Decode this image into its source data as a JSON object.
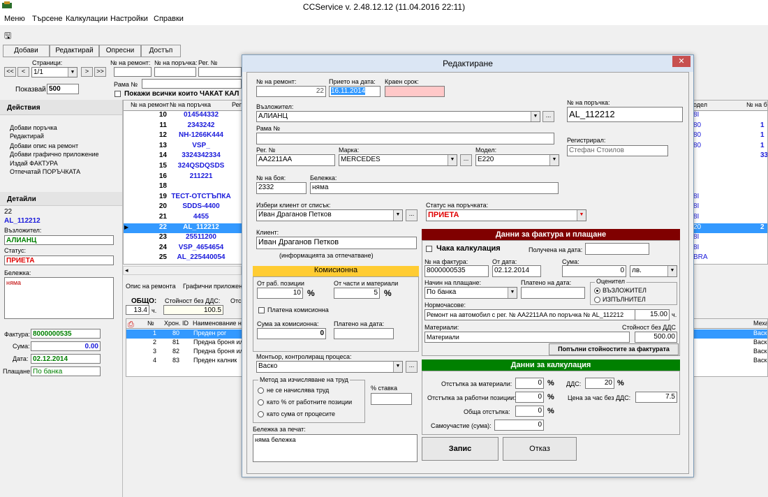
{
  "app": {
    "title": "CCService v. 2.48.12.12 (11.04.2016 22:11)"
  },
  "menu": [
    "Меню",
    "Търсене",
    "Калкулации",
    "Настройки",
    "Справки"
  ],
  "tabs": [
    "Добави",
    "Редактирай",
    "Опресни",
    "Достъп"
  ],
  "filters": {
    "pages_label": "Страници:",
    "pages_value": "1/1",
    "show_label": "Показвай",
    "show_value": "500",
    "repair_no_label": "№ на ремонт:",
    "order_no_label": "№ на поръчка:",
    "reg_no_label": "Рег. №",
    "frame_label": "Рама №",
    "checkbox_label": "Покажи всички които ЧАКАТ КАЛ"
  },
  "actions": {
    "title": "Действия",
    "items": [
      "Добави поръчка",
      "Редактирай",
      "Добави опис на ремонт",
      "Добави графично приложение",
      "Издай ФАКТУРА",
      "Отпечатай ПОРЪЧКАТА"
    ]
  },
  "details": {
    "title": "Детайли",
    "repair_no": "22",
    "order_no": "AL_112212",
    "client_label": "Възложител:",
    "client": "АЛИАНЦ",
    "status_label": "Статус:",
    "status": "ПРИЕТА",
    "note_label": "Бележка:",
    "note": "няма",
    "invoice_label": "Фактура:",
    "invoice": "8000000535",
    "sum_label": "Сума:",
    "sum": "0.00",
    "date_label": "Дата:",
    "date": "02.12.2014",
    "payment_label": "Плащане:",
    "payment": "По банка"
  },
  "grid": {
    "headers": [
      "№ на ремонт",
      "№ на поръчка",
      "Рег",
      "одел",
      "№ на бо"
    ],
    "rows": [
      {
        "n": "10",
        "o": "014544332",
        "m": "8I",
        "x": ""
      },
      {
        "n": "11",
        "o": "2343242",
        "m": "80",
        "x": "1"
      },
      {
        "n": "12",
        "o": "NH-1266K444",
        "m": "80",
        "x": "1"
      },
      {
        "n": "13",
        "o": "VSP_",
        "m": "80",
        "x": "1"
      },
      {
        "n": "14",
        "o": "3324342334",
        "m": "",
        "x": "33"
      },
      {
        "n": "15",
        "o": "324QSDQSDS",
        "m": "",
        "x": ""
      },
      {
        "n": "16",
        "o": "211221",
        "m": "",
        "x": ""
      },
      {
        "n": "18",
        "o": "",
        "m": "",
        "x": ""
      },
      {
        "n": "19",
        "o": "ТЕСТ-ОТСТЪПКА",
        "m": "8I",
        "x": ""
      },
      {
        "n": "20",
        "o": "SDDS-4400",
        "m": "8I",
        "x": ""
      },
      {
        "n": "21",
        "o": "4455",
        "m": "8I",
        "x": ""
      },
      {
        "n": "22",
        "o": "AL_112212",
        "m": "20",
        "x": "2"
      },
      {
        "n": "23",
        "o": "25511200",
        "m": "8I",
        "x": ""
      },
      {
        "n": "24",
        "o": "VSP_4654654",
        "m": "8I",
        "x": ""
      },
      {
        "n": "25",
        "o": "AL_225440054",
        "m": "BRA",
        "x": ""
      }
    ]
  },
  "bottom": {
    "tabs": [
      "Опис на ремонта",
      "Графични приложен"
    ],
    "total_label": "ОБЩО:",
    "total_h": "13.4",
    "h_unit": "ч.",
    "net_label": "Стойност без ДДС:",
    "net": "100.5",
    "other": "Отс",
    "items_headers": [
      "№",
      "Хрон. ID",
      "Наименование на",
      "Меха"
    ],
    "items": [
      {
        "n": "1",
        "id": "80",
        "name": "Преден рог",
        "m": "Васк"
      },
      {
        "n": "2",
        "id": "81",
        "name": "Предна броня или",
        "m": "Васк"
      },
      {
        "n": "3",
        "id": "82",
        "name": "Предна броня или",
        "m": "Васк"
      },
      {
        "n": "4",
        "id": "83",
        "name": "Преден калник",
        "m": "Васк"
      }
    ]
  },
  "dialog": {
    "title": "Редактиране",
    "repair_no_label": "№ на ремонт:",
    "repair_no": "22",
    "received_label": "Прието на дата:",
    "received": "16.11.2014",
    "deadline_label": "Краен срок:",
    "deadline": "",
    "order_label": "№ на поръчка:",
    "order": "AL_112212",
    "client_label": "Възложител:",
    "client": "АЛИАНЦ",
    "frame_label": "Рама №",
    "frame": "",
    "registered_label": "Регистрирал:",
    "registered": "Стефан Стоилов",
    "reg_label": "Рег. №",
    "reg": "AA2211AA",
    "brand_label": "Марка:",
    "brand": "MERCEDES",
    "model_label": "Модел:",
    "model": "E220",
    "paint_label": "№ на боя:",
    "paint": "2332",
    "note_label": "Бележка:",
    "note": "няма",
    "choose_client_label": "Избери клиент от списък:",
    "choose_client": "Иван Драганов Петков",
    "status_label": "Статус на поръчката:",
    "status": "ПРИЕТА",
    "customer_label": "Клиент:",
    "customer": "Иван Драганов Петков",
    "customer_hint": "(информацията за отпечатване)",
    "commission": {
      "title": "Комисионна",
      "labor_label": "От раб. позиции",
      "labor": "10",
      "parts_label": "От части и материали",
      "parts": "5",
      "pct": "%",
      "paid_label": "Платена комисионна",
      "sum_label": "Сума за комисионна:",
      "sum": "0",
      "paid_date_label": "Платено на дата:"
    },
    "mechanic_label": "Монтьор, контролиращ процеса:",
    "mechanic": "Васко",
    "method": {
      "title": "Метод за изчисляване на труд",
      "opt1": "не се начислява труд",
      "opt2": "като % от работните позиции",
      "opt3": "като сума от процесите",
      "rate_label": "% ставка"
    },
    "print_note_label": "Бележка за печат:",
    "print_note": "няма бележка",
    "invoice": {
      "title": "Данни за фактура и плащане",
      "wait_label": "Чака калкулация",
      "received_label": "Получена на дата:",
      "no_label": "№ на фактура:",
      "no": "8000000535",
      "date_label": "От дата:",
      "date": "02.12.2014",
      "sum_label": "Сума:",
      "sum": "0",
      "currency": "лв.",
      "pay_label": "Начин на плащане:",
      "pay": "По банка",
      "paid_label": "Платено на дата:",
      "evaluator_label": "Оценител",
      "eval1": "ВЪЗЛОЖИТЕЛ",
      "eval2": "ИЗПЪЛНИТЕЛ",
      "hours_label": "Нормочасове:",
      "hours_text": "Ремонт на автомобил с рег. № AA2211AA по поръчка № AL_112212",
      "hours": "15.00",
      "h_unit": "ч.",
      "materials_label": "Материали:",
      "net_label": "Стойност без ДДС",
      "materials": "Материали",
      "materials_value": "500.00",
      "fill_button": "Попълни стойностите за фактурата"
    },
    "calc": {
      "title": "Данни за калкулация",
      "mat_disc_label": "Отстъпка за материали:",
      "mat_disc": "0",
      "work_disc_label": "Отстъпка за работни позиции:",
      "work_disc": "0",
      "total_disc_label": "Обща отстъпка:",
      "total_disc": "0",
      "self_label": "Самоучастие (сума):",
      "self": "0",
      "vat_label": "ДДС:",
      "vat": "20",
      "rate_label": "Цена за час без ДДС:",
      "rate": "7.5",
      "pct": "%"
    },
    "save": "Запис",
    "cancel": "Отказ"
  }
}
